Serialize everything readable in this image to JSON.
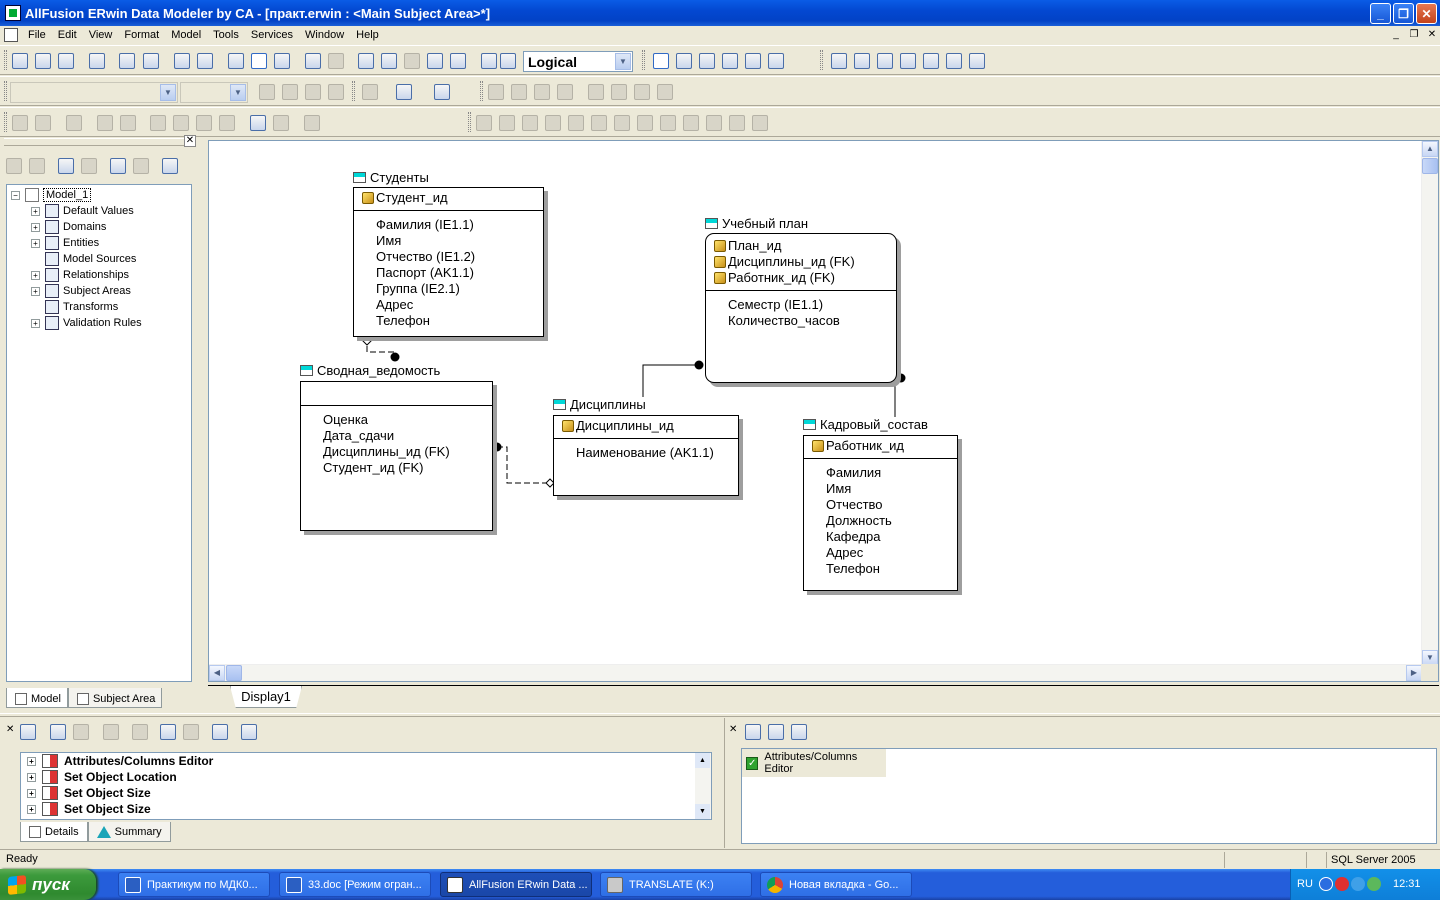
{
  "window": {
    "title": "AllFusion ERwin Data Modeler by CA - [практ.erwin : <Main Subject Area>*]",
    "minimize": "_",
    "maximize": "❐",
    "close": "✕"
  },
  "menu": [
    "File",
    "Edit",
    "View",
    "Format",
    "Model",
    "Tools",
    "Services",
    "Window",
    "Help"
  ],
  "toolbar": {
    "view_level": "Logical"
  },
  "explorer": {
    "close": "✕",
    "tree": [
      {
        "label": "Model_1",
        "expander": "−",
        "icon": "model-document-icon"
      },
      {
        "label": "Default Values",
        "expander": "+",
        "icon": "default-values-icon"
      },
      {
        "label": "Domains",
        "expander": "+",
        "icon": "domains-icon"
      },
      {
        "label": "Entities",
        "expander": "+",
        "icon": "entities-icon"
      },
      {
        "label": "Model Sources",
        "expander": "",
        "icon": "model-sources-icon"
      },
      {
        "label": "Relationships",
        "expander": "+",
        "icon": "relationships-icon"
      },
      {
        "label": "Subject Areas",
        "expander": "+",
        "icon": "subject-areas-icon"
      },
      {
        "label": "Transforms",
        "expander": "",
        "icon": "transforms-icon"
      },
      {
        "label": "Validation Rules",
        "expander": "+",
        "icon": "validation-rules-icon"
      }
    ],
    "tabs": [
      "Model",
      "Subject Area"
    ]
  },
  "diagram": {
    "tab": "Display1",
    "entities": {
      "students": {
        "name": "Студенты",
        "keys": [
          "Студент_ид"
        ],
        "attrs": [
          "Фамилия (IE1.1)",
          "Имя",
          "Отчество (IE1.2)",
          "Паспорт (AK1.1)",
          "Группа (IE2.1)",
          "Адрес",
          "Телефон"
        ]
      },
      "plan": {
        "name": "Учебный план",
        "keys": [
          "План_ид",
          "Дисциплины_ид (FK)",
          "Работник_ид (FK)"
        ],
        "attrs": [
          "Семестр (IE1.1)",
          "Количество_часов"
        ]
      },
      "summary": {
        "name": "Сводная_ведомость",
        "keys": [],
        "attrs": [
          "Оценка",
          "Дата_сдачи",
          "Дисциплины_ид (FK)",
          "Студент_ид (FK)"
        ]
      },
      "disciplines": {
        "name": "Дисциплины",
        "keys": [
          "Дисциплины_ид"
        ],
        "attrs": [
          "Наименование (AK1.1)"
        ]
      },
      "staff": {
        "name": "Кадровый_состав",
        "keys": [
          "Работник_ид"
        ],
        "attrs": [
          "Фамилия",
          "Имя",
          "Отчество",
          "Должность",
          "Кафедра",
          "Адрес",
          "Телефон"
        ]
      }
    }
  },
  "actions": {
    "close": "✕",
    "items": [
      "Attributes/Columns Editor",
      "Set Object Location",
      "Set Object Size",
      "Set Object Size"
    ],
    "tabs": [
      "Details",
      "Summary"
    ]
  },
  "editor_pane": {
    "close": "✕",
    "item": "Attributes/Columns Editor"
  },
  "status": {
    "left": "Ready",
    "db": "SQL Server 2005"
  },
  "taskbar": {
    "start": "пуск",
    "tasks": [
      "Практикум по МДК0...",
      "33.doc [Режим огран...",
      "AllFusion ERwin Data ...",
      "TRANSLATE (K:)",
      "Новая вкладка - Go..."
    ],
    "lang": "RU",
    "clock": "12:31"
  }
}
